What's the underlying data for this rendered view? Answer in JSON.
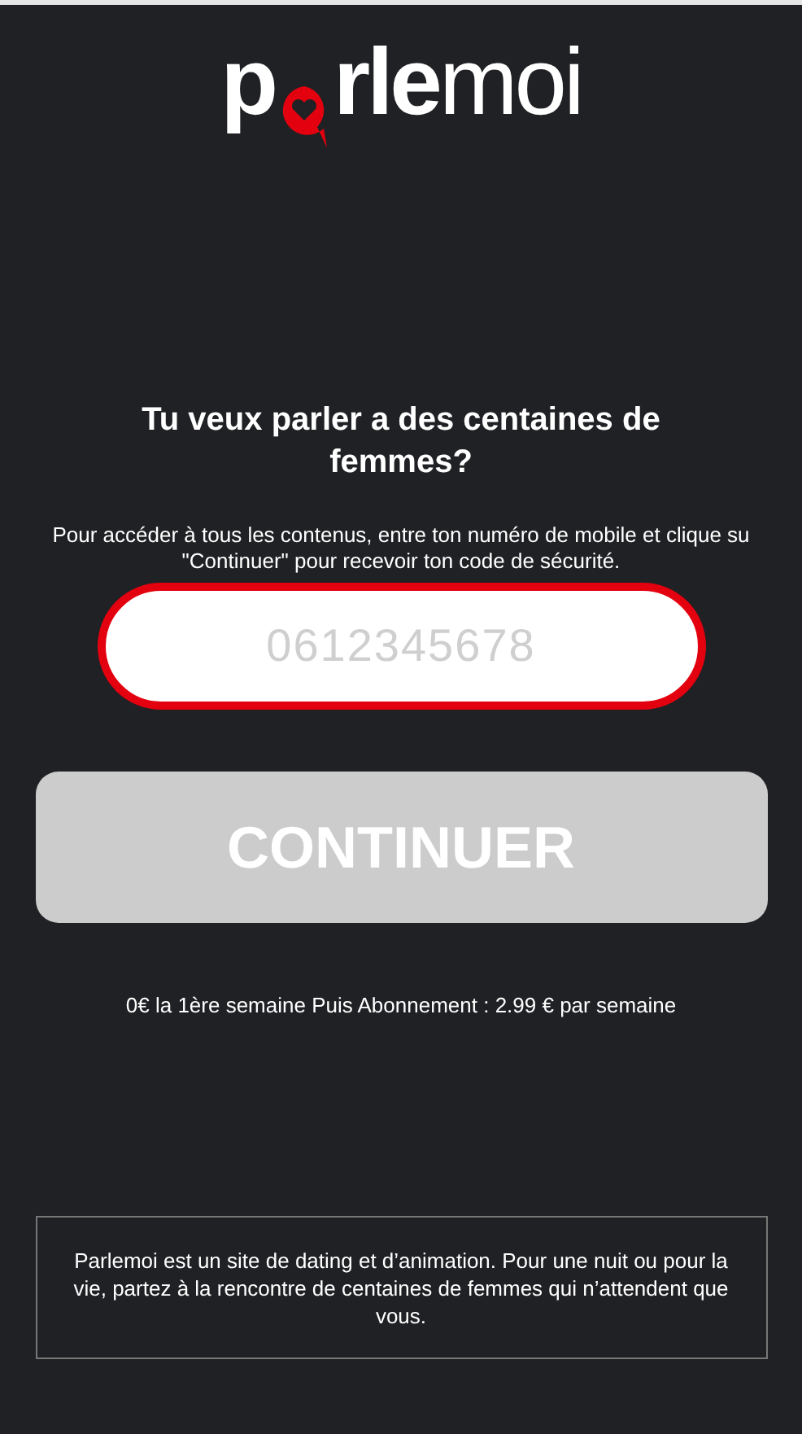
{
  "logo": {
    "start": "p",
    "bold": "rle",
    "light": "moi"
  },
  "heading": "Tu veux parler a des centaines de femmes?",
  "instructions": [
    "Pour accéder à tous les contenus, entre ton numéro de mobile et clique su",
    "\"Continuer\" pour recevoir ton code de sécurité."
  ],
  "phone_field": {
    "placeholder": "0612345678"
  },
  "continue_button": {
    "label": "CONTINUER",
    "disabled": true
  },
  "pricing": "0€ la 1ère semaine Puis Abonnement : 2.99 € par semaine",
  "footer_note": "Parlemoi est un site de dating et d’animation. Pour une nuit ou pour la vie, partez à la rencontre de centaines de femmes qui n’attendent que vous."
}
